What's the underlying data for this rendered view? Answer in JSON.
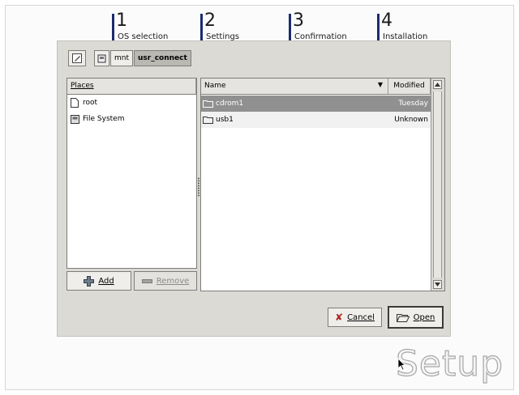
{
  "wizard": {
    "steps": [
      {
        "number": "1",
        "label": "OS selection"
      },
      {
        "number": "2",
        "label": "Settings"
      },
      {
        "number": "3",
        "label": "Confirmation"
      },
      {
        "number": "4",
        "label": "Installation"
      }
    ]
  },
  "file_dialog": {
    "path": [
      "mnt",
      "usr_connect"
    ],
    "places": {
      "header": "Places",
      "items": [
        {
          "label": "root",
          "icon": "home-folder-icon"
        },
        {
          "label": "File System",
          "icon": "drive-icon"
        }
      ],
      "add_label": "Add",
      "remove_label": "Remove"
    },
    "files": {
      "name_header": "Name",
      "modified_header": "Modified",
      "rows": [
        {
          "name": "cdrom1",
          "modified": "Tuesday",
          "selected": true
        },
        {
          "name": "usb1",
          "modified": "Unknown",
          "selected": false
        }
      ]
    },
    "cancel_label": "Cancel",
    "open_label": "Open"
  },
  "logo_text": "Setup",
  "colors": {
    "dialog_bg": "#dcdad5",
    "selected_row": "#909090",
    "step_bar": "#1c2b6e"
  }
}
